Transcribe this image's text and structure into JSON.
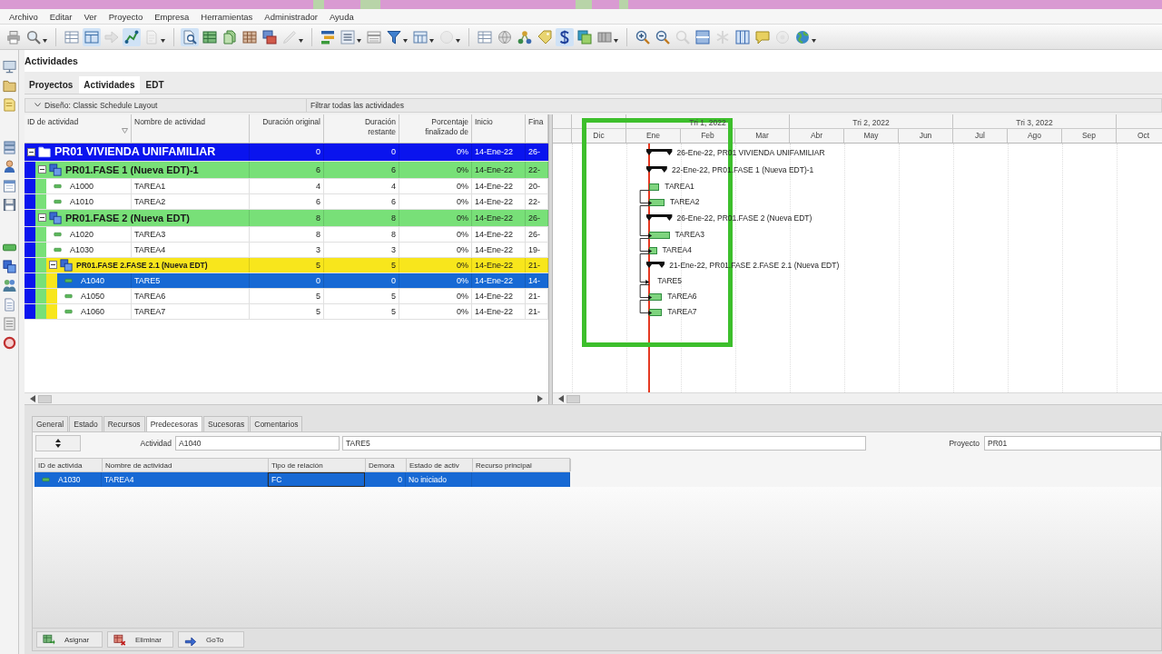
{
  "menu": [
    "Archivo",
    "Editar",
    "Ver",
    "Proyecto",
    "Empresa",
    "Herramientas",
    "Administrador",
    "Ayuda"
  ],
  "toolbar": [
    {
      "pressed": false,
      "disabled": false
    },
    {
      "pressed": false,
      "disabled": false
    },
    {
      "pressed": false,
      "disabled": false
    },
    {
      "pressed": true,
      "disabled": false
    },
    {
      "pressed": false,
      "disabled": true
    },
    {
      "pressed": true,
      "disabled": false
    },
    {
      "pressed": false,
      "disabled": true
    },
    {
      "pressed": true,
      "disabled": false
    },
    {
      "pressed": false,
      "disabled": false
    },
    {
      "pressed": false,
      "disabled": false
    },
    {
      "pressed": false,
      "disabled": false
    },
    {
      "pressed": false,
      "disabled": false
    },
    {
      "pressed": false,
      "disabled": true
    },
    {
      "pressed": false,
      "disabled": false
    },
    {
      "pressed": false,
      "disabled": false
    },
    {
      "pressed": false,
      "disabled": false
    },
    {
      "pressed": false,
      "disabled": false
    },
    {
      "pressed": false,
      "disabled": false
    },
    {
      "pressed": false,
      "disabled": true
    },
    {
      "pressed": false,
      "disabled": false
    },
    {
      "pressed": false,
      "disabled": false
    },
    {
      "pressed": false,
      "disabled": false
    },
    {
      "pressed": false,
      "disabled": false
    },
    {
      "pressed": true,
      "disabled": false
    },
    {
      "pressed": false,
      "disabled": false
    },
    {
      "pressed": false,
      "disabled": false
    },
    {
      "pressed": false,
      "disabled": false
    },
    {
      "pressed": false,
      "disabled": false
    },
    {
      "pressed": false,
      "disabled": true
    },
    {
      "pressed": false,
      "disabled": false
    },
    {
      "pressed": false,
      "disabled": true
    },
    {
      "pressed": false,
      "disabled": false
    },
    {
      "pressed": false,
      "disabled": false
    },
    {
      "pressed": false,
      "disabled": true
    },
    {
      "pressed": false,
      "disabled": false
    }
  ],
  "page_title": "Actividades",
  "tabs": [
    {
      "label": "Proyectos",
      "selected": false
    },
    {
      "label": "Actividades",
      "selected": true
    },
    {
      "label": "EDT",
      "selected": false
    }
  ],
  "layout_bar": {
    "layout": "Diseño: Classic Schedule Layout",
    "filter": "Filtrar todas las actividades"
  },
  "table": {
    "columns": [
      "ID de actividad",
      "Nombre de actividad",
      "Duración original",
      "Duración restante",
      "Porcentaje finalizado de",
      "Inicio",
      "Fina"
    ],
    "rows": [
      {
        "kind": "project",
        "name": "PR01 VIVIENDA UNIFAMILIAR",
        "color": "#0a14ee",
        "expanded": true,
        "selected": false,
        "orig": "0",
        "rem": "0",
        "pct": "0%",
        "start": "14-Ene-22",
        "finish": "26-",
        "children": [
          {
            "kind": "wbs",
            "name": "PR01.FASE 1 (Nueva EDT)-1",
            "color": "#78e078",
            "expanded": true,
            "selected": false,
            "orig": "6",
            "rem": "6",
            "pct": "0%",
            "start": "14-Ene-22",
            "finish": "22-",
            "children": [
              {
                "kind": "activity",
                "id": "A1000",
                "name": "TAREA1",
                "selected": false,
                "orig": "4",
                "rem": "4",
                "pct": "0%",
                "start": "14-Ene-22",
                "finish": "20-"
              },
              {
                "kind": "activity",
                "id": "A1010",
                "name": "TAREA2",
                "selected": false,
                "orig": "6",
                "rem": "6",
                "pct": "0%",
                "start": "14-Ene-22",
                "finish": "22-"
              }
            ]
          },
          {
            "kind": "wbs",
            "name": "PR01.FASE 2 (Nueva EDT)",
            "color": "#78e078",
            "expanded": true,
            "selected": false,
            "orig": "8",
            "rem": "8",
            "pct": "0%",
            "start": "14-Ene-22",
            "finish": "26-",
            "children": [
              {
                "kind": "activity",
                "id": "A1020",
                "name": "TAREA3",
                "selected": false,
                "orig": "8",
                "rem": "8",
                "pct": "0%",
                "start": "14-Ene-22",
                "finish": "26-"
              },
              {
                "kind": "activity",
                "id": "A1030",
                "name": "TAREA4",
                "selected": false,
                "orig": "3",
                "rem": "3",
                "pct": "0%",
                "start": "14-Ene-22",
                "finish": "19-"
              },
              {
                "kind": "wbs",
                "name": "PR01.FASE 2.FASE 2.1 (Nueva EDT)",
                "color": "#f8e61c",
                "expanded": true,
                "selected": false,
                "orig": "5",
                "rem": "5",
                "pct": "0%",
                "start": "14-Ene-22",
                "finish": "21-",
                "children": [
                  {
                    "kind": "activity",
                    "id": "A1040",
                    "name": "TARE5",
                    "selected": true,
                    "orig": "0",
                    "rem": "0",
                    "pct": "0%",
                    "start": "14-Ene-22",
                    "finish": "14-"
                  },
                  {
                    "kind": "activity",
                    "id": "A1050",
                    "name": "TAREA6",
                    "selected": false,
                    "orig": "5",
                    "rem": "5",
                    "pct": "0%",
                    "start": "14-Ene-22",
                    "finish": "21-"
                  },
                  {
                    "kind": "activity",
                    "id": "A1060",
                    "name": "TAREA7",
                    "selected": false,
                    "orig": "5",
                    "rem": "5",
                    "pct": "0%",
                    "start": "14-Ene-22",
                    "finish": "21-"
                  }
                ]
              }
            ]
          }
        ]
      }
    ]
  },
  "gantt": {
    "timescale": [
      {
        "months": [
          "Dic"
        ]
      },
      {
        "label": "Tri 1, 2022",
        "months": [
          "Ene",
          "Feb",
          "Mar"
        ]
      },
      {
        "label": "Tri 2, 2022",
        "months": [
          "Abr",
          "May",
          "Jun"
        ]
      },
      {
        "label": "Tri 3, 2022",
        "months": [
          "Jul",
          "Ago",
          "Sep"
        ]
      },
      {
        "months": [
          "Oct"
        ]
      }
    ],
    "bars": [
      {
        "kind": "summary",
        "label": "26-Ene-22, PR01 VIVIENDA UNIFAMILIAR",
        "linked": false
      },
      {
        "kind": "summary",
        "label": "22-Ene-22, PR01.FASE 1 (Nueva EDT)-1",
        "linked": false
      },
      {
        "kind": "task",
        "label": "TAREA1",
        "linked": false
      },
      {
        "kind": "task",
        "label": "TAREA2",
        "linked": true
      },
      {
        "kind": "summary",
        "label": "26-Ene-22, PR01.FASE 2 (Nueva EDT)",
        "linked": false
      },
      {
        "kind": "task",
        "label": "TAREA3",
        "linked": true
      },
      {
        "kind": "task",
        "label": "TAREA4",
        "linked": true
      },
      {
        "kind": "summary",
        "label": "21-Ene-22, PR01.FASE 2.FASE 2.1 (Nueva EDT)",
        "linked": false
      },
      {
        "kind": "milestone",
        "label": "TARE5",
        "linked": true
      },
      {
        "kind": "task",
        "label": "TAREA6",
        "linked": true
      },
      {
        "kind": "task",
        "label": "TAREA7",
        "linked": true
      }
    ]
  },
  "details": {
    "tabs": [
      {
        "label": "General",
        "selected": false
      },
      {
        "label": "Estado",
        "selected": false
      },
      {
        "label": "Recursos",
        "selected": false
      },
      {
        "label": "Predecesoras",
        "selected": true
      },
      {
        "label": "Sucesoras",
        "selected": false
      },
      {
        "label": "Comentarios",
        "selected": false
      }
    ],
    "activity_label": "Actividad",
    "activity_id": "A1040",
    "activity_name": "TARE5",
    "project_label": "Proyecto",
    "project": "PR01",
    "columns": [
      "ID de activida",
      "Nombre de actividad",
      "Tipo de relación",
      "Demora",
      "Estado de activ",
      "Recurso principal"
    ],
    "rows": [
      {
        "id": "A1030",
        "name": "TAREA4",
        "relation": "FC",
        "lag": "0",
        "status": "No iniciado",
        "selected": true
      }
    ],
    "buttons": [
      "Asignar",
      "Eliminar",
      "GoTo"
    ]
  }
}
